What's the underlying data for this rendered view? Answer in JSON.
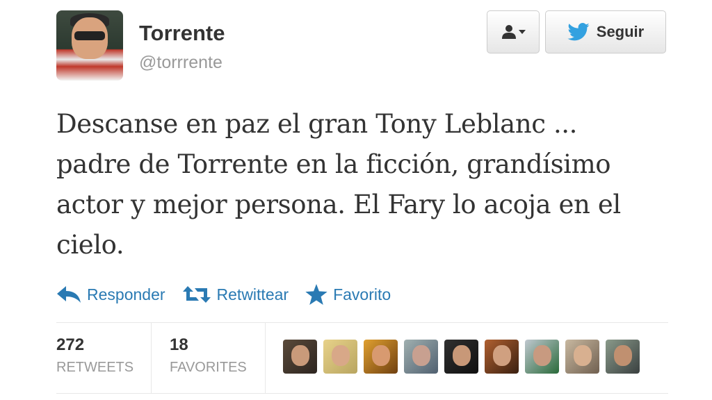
{
  "profile": {
    "name": "Torrente",
    "handle": "@torrrente"
  },
  "buttons": {
    "user_menu_icon": "user-icon",
    "follow_label": "Seguir",
    "follow_icon": "twitter-bird-icon"
  },
  "tweet": {
    "lines": [
      "Descanse en paz el gran Tony Leblanc ...",
      "padre de Torrente en la ficción, grandísimo",
      "actor y mejor persona. El Fary lo acoja en el",
      "cielo."
    ]
  },
  "actions": {
    "reply": "Responder",
    "retweet": "Retwittear",
    "favorite": "Favorito"
  },
  "stats": {
    "retweets_count": "272",
    "retweets_label": "RETWEETS",
    "favorites_count": "18",
    "favorites_label": "FAVORITES"
  },
  "colors": {
    "accent": "#2a7ab3",
    "twitter_blue": "#33a1e0",
    "muted": "#999999"
  }
}
